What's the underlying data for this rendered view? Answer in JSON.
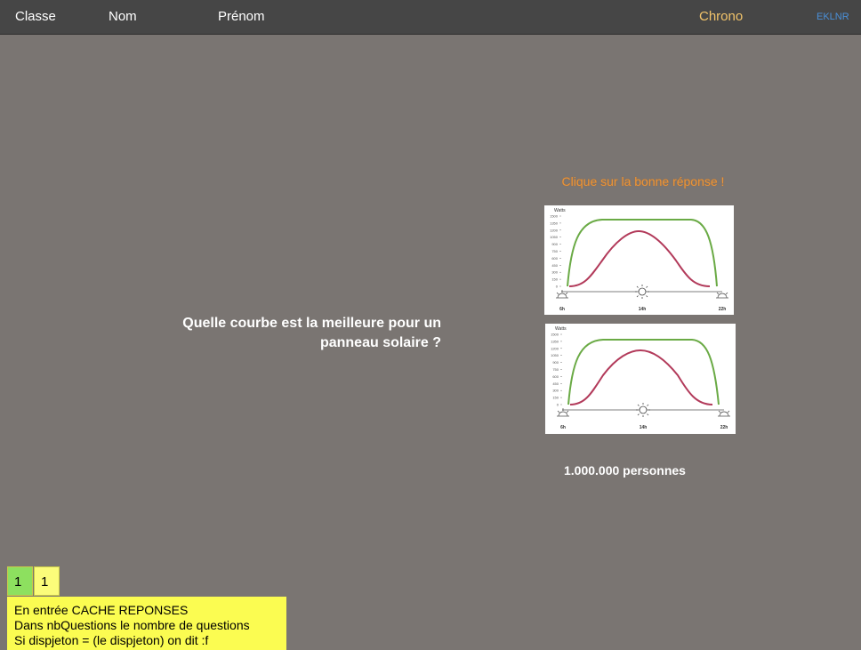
{
  "header": {
    "classe_label": "Classe",
    "nom_label": "Nom",
    "prenom_label": "Prénom",
    "chrono_label": "Chrono",
    "code_label": "EKLNR"
  },
  "question": {
    "text": "Quelle courbe est la meilleure pour un panneau solaire ?"
  },
  "instruction": "Clique sur la bonne réponse !",
  "answers": [
    {
      "ylabel": "Watts",
      "yticks": [
        "1500",
        "1350",
        "1200",
        "1050",
        "900",
        "750",
        "600",
        "450",
        "300",
        "150",
        "0"
      ],
      "xticks": [
        "6h",
        "14h",
        "22h"
      ]
    },
    {
      "ylabel": "Watts",
      "yticks": [
        "1500",
        "1350",
        "1200",
        "1050",
        "900",
        "750",
        "600",
        "450",
        "300",
        "150",
        "0"
      ],
      "xticks": [
        "6h",
        "14h",
        "22h"
      ]
    }
  ],
  "answer_text": "1.000.000 personnes",
  "counters": [
    "1",
    "1"
  ],
  "notes": [
    "En entrée CACHE REPONSES",
    "Dans nbQuestions le nombre de questions",
    "Si dispjeton = (le dispjeton) on dit :f"
  ],
  "colors": {
    "background": "#7a7572",
    "topbar": "#464646",
    "chrono": "#f2c46a",
    "code": "#4a90d9",
    "instruction": "#e8953c",
    "green_curve": "#6aaa45",
    "red_curve": "#b23a5a",
    "notes_bg": "#fbfc51",
    "counter_green": "#8de05f"
  }
}
